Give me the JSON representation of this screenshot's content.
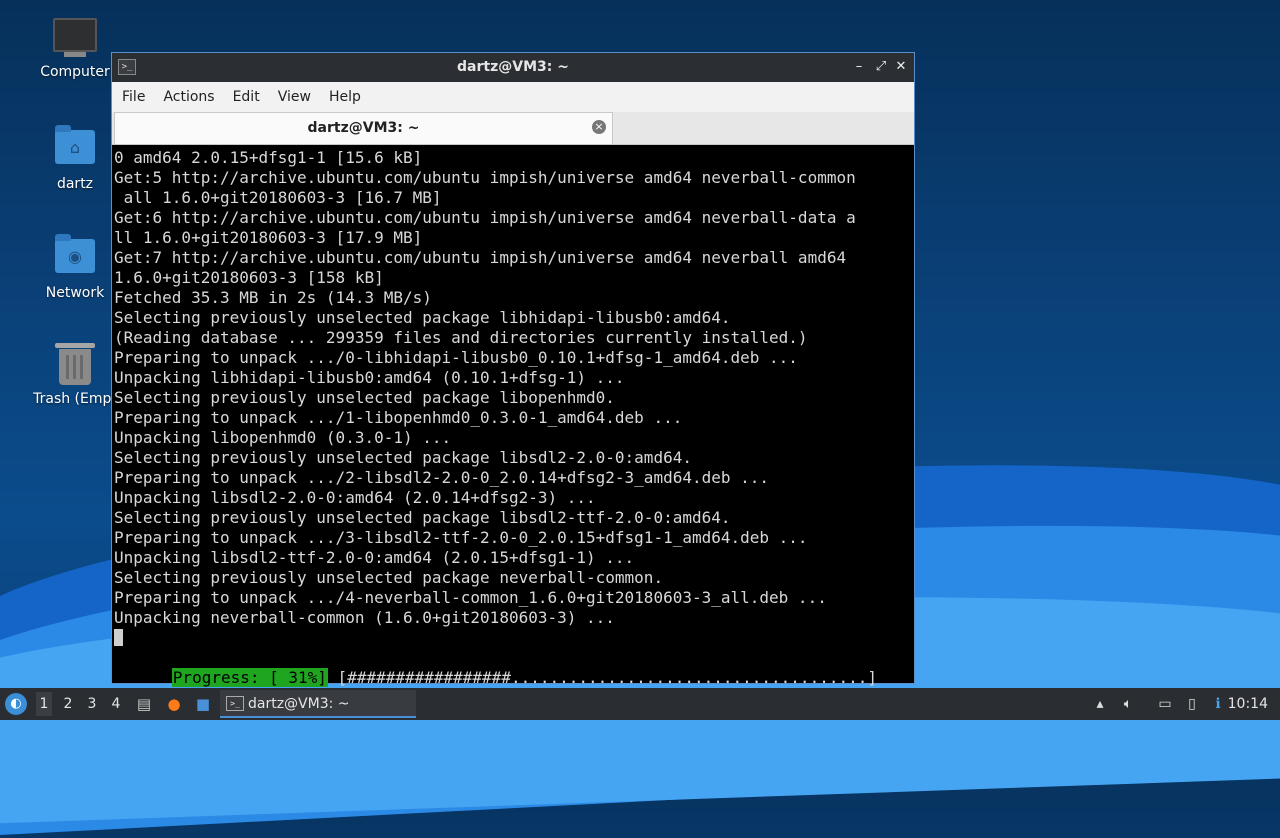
{
  "desktop": {
    "icons": [
      {
        "label": "Computer",
        "icon": "computer-icon"
      },
      {
        "label": "dartz",
        "icon": "home-folder-icon"
      },
      {
        "label": "Network",
        "icon": "network-folder-icon"
      },
      {
        "label": "Trash (Empt",
        "icon": "trash-icon"
      }
    ]
  },
  "window": {
    "title": "dartz@VM3: ~",
    "menu": [
      "File",
      "Actions",
      "Edit",
      "View",
      "Help"
    ],
    "tab_label": "dartz@VM3: ~",
    "accent": "#5b8fc9"
  },
  "terminal": {
    "lines": [
      "0 amd64 2.0.15+dfsg1-1 [15.6 kB]",
      "Get:5 http://archive.ubuntu.com/ubuntu impish/universe amd64 neverball-common",
      " all 1.6.0+git20180603-3 [16.7 MB]",
      "Get:6 http://archive.ubuntu.com/ubuntu impish/universe amd64 neverball-data a",
      "ll 1.6.0+git20180603-3 [17.9 MB]",
      "Get:7 http://archive.ubuntu.com/ubuntu impish/universe amd64 neverball amd64",
      "1.6.0+git20180603-3 [158 kB]",
      "Fetched 35.3 MB in 2s (14.3 MB/s)",
      "Selecting previously unselected package libhidapi-libusb0:amd64.",
      "(Reading database ... 299359 files and directories currently installed.)",
      "Preparing to unpack .../0-libhidapi-libusb0_0.10.1+dfsg-1_amd64.deb ...",
      "Unpacking libhidapi-libusb0:amd64 (0.10.1+dfsg-1) ...",
      "Selecting previously unselected package libopenhmd0.",
      "Preparing to unpack .../1-libopenhmd0_0.3.0-1_amd64.deb ...",
      "Unpacking libopenhmd0 (0.3.0-1) ...",
      "Selecting previously unselected package libsdl2-2.0-0:amd64.",
      "Preparing to unpack .../2-libsdl2-2.0-0_2.0.14+dfsg2-3_amd64.deb ...",
      "Unpacking libsdl2-2.0-0:amd64 (2.0.14+dfsg2-3) ...",
      "Selecting previously unselected package libsdl2-ttf-2.0-0:amd64.",
      "Preparing to unpack .../3-libsdl2-ttf-2.0-0_2.0.15+dfsg1-1_amd64.deb ...",
      "Unpacking libsdl2-ttf-2.0-0:amd64 (2.0.15+dfsg1-1) ...",
      "Selecting previously unselected package neverball-common.",
      "Preparing to unpack .../4-neverball-common_1.6.0+git20180603-3_all.deb ...",
      "Unpacking neverball-common (1.6.0+git20180603-3) ..."
    ],
    "progress_label": "Progress: [ 31%]",
    "progress_bar": " [#################.....................................]",
    "progress_percent": 31,
    "progress_color": "#1fa51f"
  },
  "taskbar": {
    "workspaces": [
      "1",
      "2",
      "3",
      "4"
    ],
    "active_workspace": "1",
    "task_label": "dartz@VM3: ~",
    "clock": "10:14"
  }
}
